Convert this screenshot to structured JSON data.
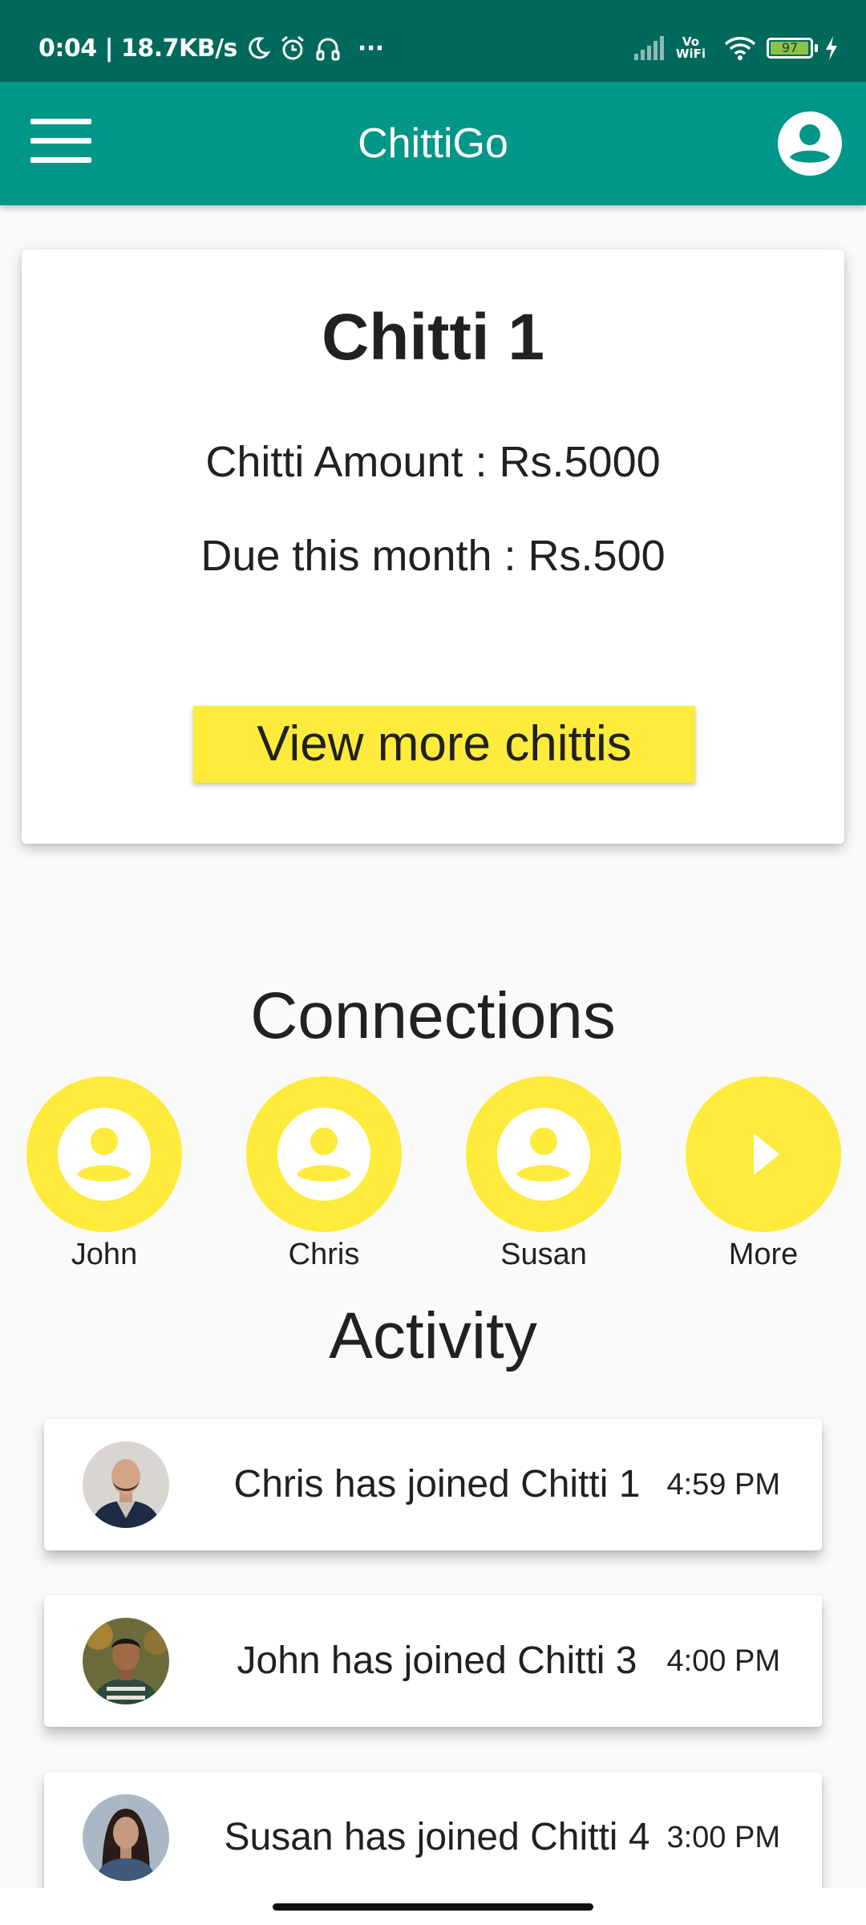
{
  "status_bar": {
    "text": "0:04 | 18.7KB/s",
    "more": "···",
    "network_label_top": "Vo",
    "network_label_bottom": "WiFi",
    "battery_percent": "97",
    "battery_level": 0.97,
    "background_color": "#00695c",
    "icons": [
      "moon-icon",
      "alarm-icon",
      "headphones-icon",
      "signal-icon",
      "wifi-icon",
      "battery-icon",
      "charging-icon"
    ]
  },
  "app_bar": {
    "title": "ChittiGo",
    "background_color": "#009688",
    "menu_icon": "hamburger-menu-icon",
    "account_icon": "account-circle-icon"
  },
  "chitti_card": {
    "title": "Chitti 1",
    "amount_text": "Chitti Amount : Rs.5000",
    "due_text": "Due this month : Rs.500",
    "button_label": "View more chittis",
    "button_color": "#ffeb3b"
  },
  "connections": {
    "title": "Connections",
    "items": [
      {
        "label": "John",
        "icon": "person-icon"
      },
      {
        "label": "Chris",
        "icon": "person-icon"
      },
      {
        "label": "Susan",
        "icon": "person-icon"
      },
      {
        "label": "More",
        "icon": "play-arrow-icon"
      }
    ],
    "circle_color": "#ffeb3b"
  },
  "activity": {
    "title": "Activity",
    "items": [
      {
        "text": "Chris has joined Chitti 1",
        "time": "4:59 PM",
        "avatar": "avatar-photo"
      },
      {
        "text": "John has joined Chitti 3",
        "time": "4:00 PM",
        "avatar": "avatar-photo"
      },
      {
        "text": "Susan has joined Chitti 4",
        "time": "3:00 PM",
        "avatar": "avatar-photo"
      }
    ]
  }
}
